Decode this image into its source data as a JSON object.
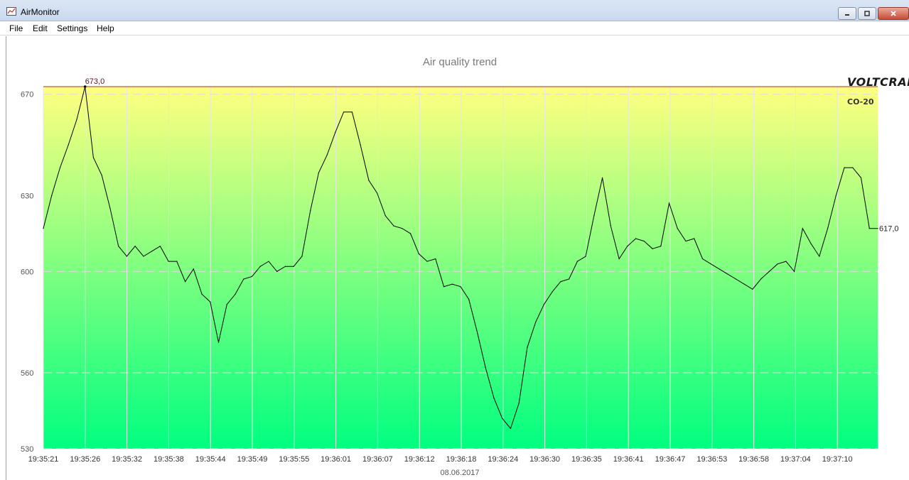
{
  "window": {
    "title": "AirMonitor",
    "icon": "chart-line-icon"
  },
  "menu": {
    "items": [
      "File",
      "Edit",
      "Settings",
      "Help"
    ]
  },
  "brand": {
    "name": "VOLTCRAFT",
    "model": "CO-20"
  },
  "colors": {
    "gradient_top": "#ffff80",
    "gradient_bottom": "#00ff80",
    "max_line": "#b03020",
    "series_line": "#000000"
  },
  "chart_data": {
    "type": "line",
    "title": "Air quality trend",
    "xlabel": "08.06.2017",
    "ylabel": "",
    "ylim": [
      530,
      673
    ],
    "yticks": [
      530,
      560,
      600,
      630,
      670
    ],
    "grid": true,
    "x_tick_labels": [
      "19:35:21",
      "19:35:26",
      "19:35:32",
      "19:35:38",
      "19:35:44",
      "19:35:49",
      "19:35:55",
      "19:36:01",
      "19:36:07",
      "19:36:12",
      "19:36:18",
      "19:36:24",
      "19:36:30",
      "19:36:35",
      "19:36:41",
      "19:36:47",
      "19:36:53",
      "19:36:58",
      "19:37:04",
      "19:37:10"
    ],
    "annotations": {
      "max_label": "673,0",
      "last_label": "617,0"
    },
    "series": [
      {
        "values": [
          617,
          630,
          641,
          650,
          660,
          673,
          645,
          638,
          625,
          610,
          606,
          610,
          606,
          608,
          610,
          604,
          604,
          596,
          601,
          591,
          588,
          572,
          587,
          591,
          597,
          598,
          602,
          604,
          600,
          602,
          602,
          606,
          624,
          639,
          646,
          655,
          663,
          663,
          650,
          636,
          631,
          622,
          618,
          617,
          615,
          607,
          604,
          605,
          594,
          595,
          594,
          589,
          576,
          562,
          550,
          542,
          538,
          548,
          570,
          580,
          587,
          592,
          596,
          597,
          604,
          606,
          622,
          637,
          618,
          605,
          610,
          613,
          612,
          609,
          610,
          627,
          617,
          612,
          613,
          605,
          603,
          601,
          599,
          597,
          595,
          593,
          597,
          600,
          603,
          604,
          600,
          617,
          611,
          606,
          617,
          630,
          641,
          641,
          637,
          617,
          617
        ]
      }
    ]
  }
}
